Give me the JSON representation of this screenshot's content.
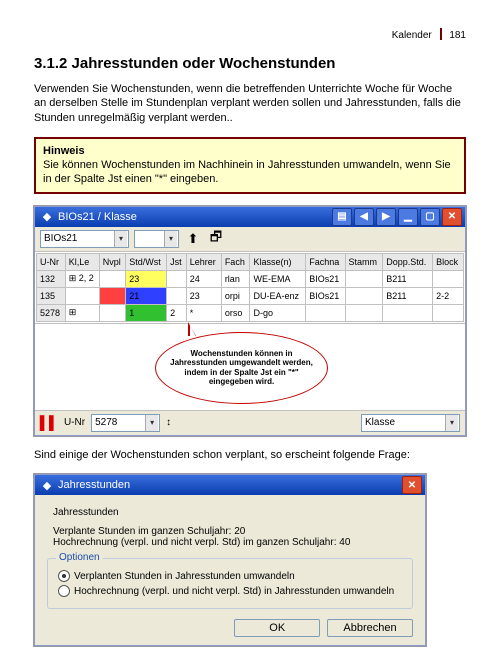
{
  "header": {
    "section": "Kalender",
    "page": "181"
  },
  "title": "3.1.2 Jahresstunden oder Wochenstunden",
  "intro": "Verwenden Sie Wochenstunden, wenn die betreffenden Unterrichte Woche für Woche an derselben Stelle im Stundenplan verplant werden sollen und Jahresstunden, falls die Stunden unregelmäßig verplant werden..",
  "hint": {
    "label": "Hinweis",
    "text": "Sie können Wochenstunden im Nachhinein in Jahresstunden umwandeln, wenn Sie in der Spalte Jst einen \"*\" eingeben."
  },
  "win1": {
    "title": "BIOs21 / Klasse",
    "combo_class": "BIOs21",
    "columns": [
      "U-Nr",
      "Kl,Le",
      "Nvpl",
      "Std/Wst",
      "Jst",
      "Lehrer",
      "Fach",
      "Klasse(n)",
      "Fachna",
      "Stamm",
      "Dopp.Std.",
      "Block"
    ],
    "rows": [
      {
        "unr": "132",
        "kle": "⊞ 2, 2",
        "nvpl": "",
        "stdwst": "23",
        "jst": "",
        "lehrer": "24",
        "fach": "rlan",
        "klassen": "WE-EMA",
        "fachna": "BIOs21",
        "stamm": "",
        "dopp": "B211",
        "block": "",
        "cc": "yellow"
      },
      {
        "unr": "135",
        "kle": "",
        "nvpl": "",
        "stdwst": "21",
        "jst": "",
        "lehrer": "23",
        "fach": "orpi",
        "klassen": "DU-EA-enz",
        "fachna": "BIOs21",
        "stamm": "",
        "dopp": "B211",
        "block": "2-2",
        "cc": "blue",
        "cc2": "red"
      },
      {
        "unr": "5278",
        "kle": "⊞",
        "nvpl": "",
        "stdwst": "1",
        "jst": "2",
        "lehrer": "*",
        "fach": "orso",
        "klassen": "D-go",
        "fachna": "",
        "stamm": "",
        "dopp": "",
        "block": "",
        "cc": "green"
      }
    ],
    "callout": "Wochenstunden können in Jahresstunden umgewandelt werden, indem in der Spalte Jst ein \"*\" eingegeben wird.",
    "bottom": {
      "label_unr": "U-Nr",
      "value_unr": "5278",
      "nav": "↕",
      "label_klasse": "Klasse"
    }
  },
  "midtext": "Sind einige der Wochenstunden schon verplant, so erscheint folgende Frage:",
  "dlg": {
    "title": "Jahresstunden",
    "heading": "Jahresstunden",
    "line1": "Verplante Stunden im ganzen Schuljahr: 20",
    "line2": "Hochrechnung (verpl. und nicht verpl. Std) im ganzen Schuljahr: 40",
    "group_label": "Optionen",
    "opt1": "Verplanten Stunden in Jahresstunden umwandeln",
    "opt2": "Hochrechnung (verpl. und nicht verpl. Std) in Jahresstunden umwandeln",
    "ok": "OK",
    "cancel": "Abbrechen"
  }
}
